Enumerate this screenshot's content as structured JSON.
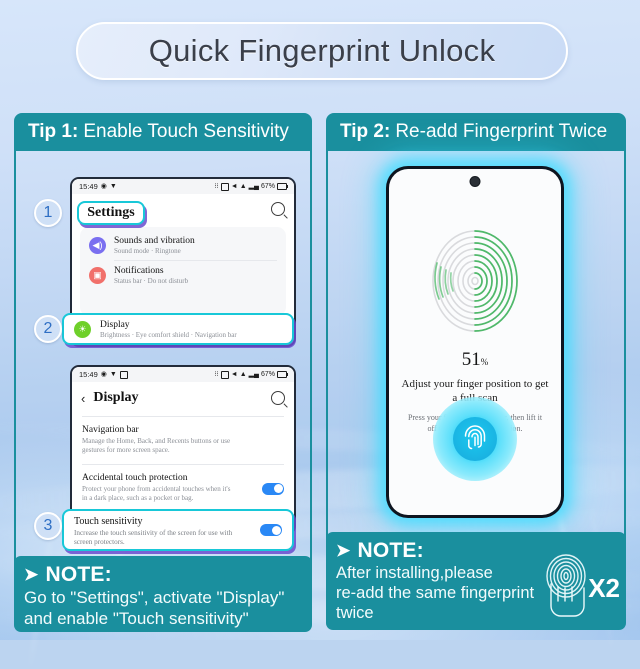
{
  "page": {
    "title": "Quick Fingerprint Unlock",
    "accent_teal": "#1a8f9e",
    "accent_cyan": "#18c8d8",
    "highlight_green": "#c9f53a"
  },
  "tip1": {
    "label_prefix": "Tip 1:",
    "label_text": "Enable Touch Sensitivity",
    "steps": [
      "1",
      "2",
      "3"
    ],
    "screen1": {
      "status": {
        "time": "15:49",
        "battery": "67%"
      },
      "title": "Settings",
      "search_icon": "search-icon",
      "items": [
        {
          "icon": "sound-icon",
          "title": "Sounds and vibration",
          "subtitle": "Sound mode  ·  Ringtone"
        },
        {
          "icon": "notification-icon",
          "title": "Notifications",
          "subtitle": "Status bar  ·  Do not disturb"
        }
      ],
      "highlighted_item": {
        "icon": "display-icon",
        "title": "Display",
        "subtitle": "Brightness  ·  Eye comfort shield  ·  Navigation bar"
      }
    },
    "screen2": {
      "status": {
        "time": "15:49",
        "battery": "67%"
      },
      "back_icon": "back-arrow-icon",
      "title": "Display",
      "search_icon": "search-icon",
      "items": [
        {
          "title": "Navigation bar",
          "subtitle": "Manage the Home, Back, and Recents buttons or use gestures for more screen space.",
          "toggle": false
        },
        {
          "title": "Accidental touch protection",
          "subtitle": "Protect your phone from accidental touches when it's in a dark place, such as a pocket or bag.",
          "toggle": true
        }
      ],
      "highlighted_item": {
        "title": "Touch sensitivity",
        "subtitle": "Increase the touch sensitivity of the screen for use with screen protectors.",
        "toggle": true
      }
    },
    "note": {
      "arrow": "➤",
      "heading": "NOTE:",
      "lines": [
        "Go to \"Settings\", activate \"Display\"",
        "and enable \"Touch sensitivity\""
      ]
    }
  },
  "tip2": {
    "label_prefix": "Tip 2:",
    "label_text": "Re-add Fingerprint Twice",
    "phone": {
      "camera_icon": "front-camera-icon",
      "fingerprint_icon": "fingerprint-progress-icon",
      "percent": "51",
      "percent_unit": "%",
      "instruction": "Adjust your finger position to get a full scan",
      "hint": "Press your finger on the sensor, then lift it off when you feel a vibration.",
      "sensor_icon": "fingerprint-sensor-icon"
    },
    "note": {
      "arrow": "➤",
      "heading": "NOTE:",
      "line1": "After installing,please",
      "line2": "re-add the same fingerprint",
      "line3_highlight": "twice",
      "badge": "X2",
      "badge_icon": "hand-fingerprint-icon"
    }
  }
}
